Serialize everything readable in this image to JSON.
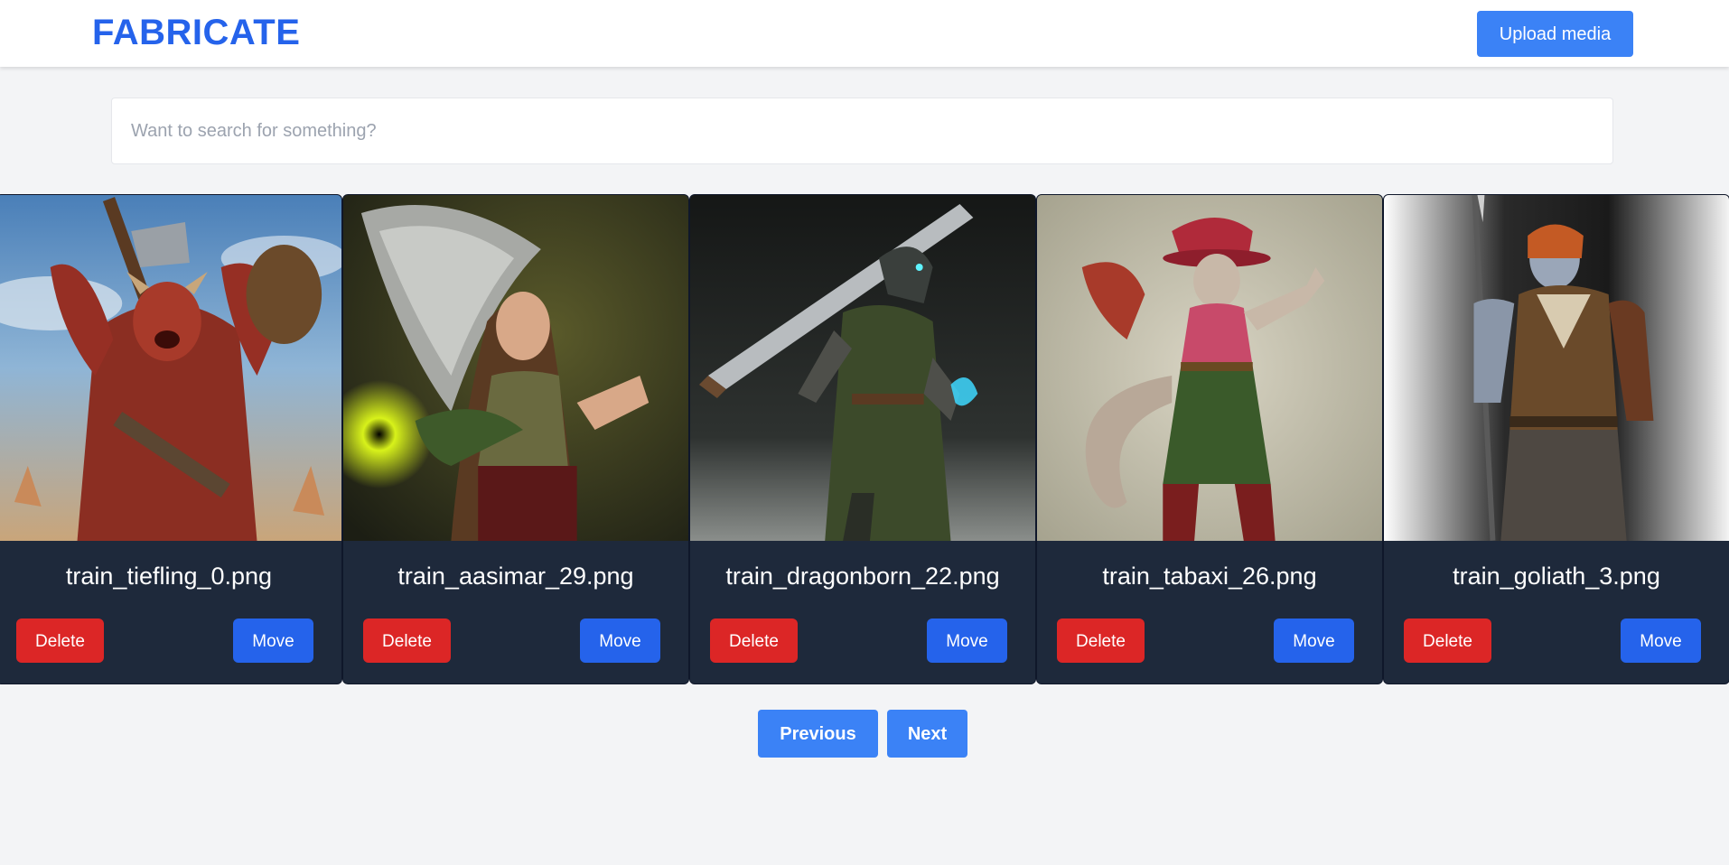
{
  "header": {
    "brand": "FABRICATE",
    "upload_label": "Upload media"
  },
  "search": {
    "placeholder": "Want to search for something?",
    "value": ""
  },
  "cards": [
    {
      "filename": "train_tiefling_0.png",
      "delete_label": "Delete",
      "move_label": "Move",
      "image_alt": "tiefling character art"
    },
    {
      "filename": "train_aasimar_29.png",
      "delete_label": "Delete",
      "move_label": "Move",
      "image_alt": "aasimar character art"
    },
    {
      "filename": "train_dragonborn_22.png",
      "delete_label": "Delete",
      "move_label": "Move",
      "image_alt": "dragonborn character art"
    },
    {
      "filename": "train_tabaxi_26.png",
      "delete_label": "Delete",
      "move_label": "Move",
      "image_alt": "tabaxi character art"
    },
    {
      "filename": "train_goliath_3.png",
      "delete_label": "Delete",
      "move_label": "Move",
      "image_alt": "goliath character art"
    }
  ],
  "pagination": {
    "previous_label": "Previous",
    "next_label": "Next"
  },
  "colors": {
    "brand": "#2563eb",
    "primary_button": "#3b82f6",
    "delete_button": "#dc2626",
    "move_button": "#2563eb",
    "card_background": "#1e293b",
    "page_background": "#f3f4f6"
  }
}
